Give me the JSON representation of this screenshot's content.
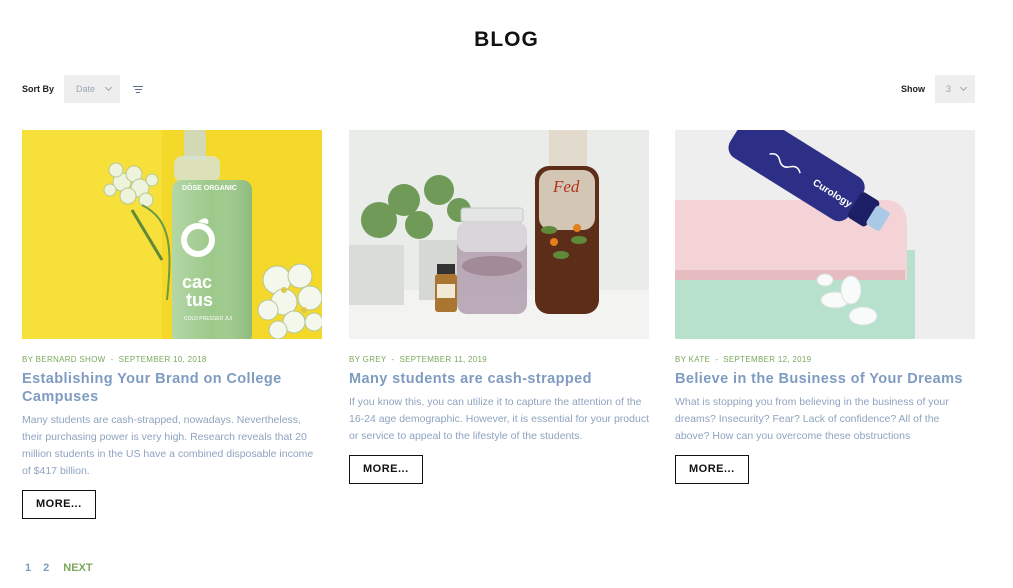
{
  "page": {
    "title": "BLOG"
  },
  "toolbar": {
    "sort_label": "Sort By",
    "sort_value": "Date",
    "show_label": "Show",
    "show_value": "3"
  },
  "posts": [
    {
      "author_prefix": "BY",
      "author": "BERNARD SHOW",
      "date": "SEPTEMBER 10, 2018",
      "title": "Establishing Your Brand on College Campuses",
      "excerpt": "Many students are cash-strapped, nowadays. Nevertheless, their purchasing power is very high. Research reveals that 20 million students in the US have a combined disposable income of $417 billion.",
      "more_label": "MORE...",
      "image": {
        "bottle_brand": "DŌSE ORGANIC",
        "bottle_word_1": "cac",
        "bottle_word_2": "tus",
        "bottle_caption": "COLD PRESSED JUI"
      }
    },
    {
      "author_prefix": "BY",
      "author": "GREY",
      "date": "SEPTEMBER 11, 2019",
      "title": "Many students are cash-strapped",
      "excerpt": "If you know this, you can utilize it to capture the attention of the 16-24 age demographic. However, it is essential for your product or service to appeal to the lifestyle of the students.",
      "more_label": "MORE...",
      "image": {
        "bottle_word": "Fed"
      }
    },
    {
      "author_prefix": "BY",
      "author": "KATE",
      "date": "SEPTEMBER 12, 2019",
      "title": "Believe in the Business of Your Dreams",
      "excerpt": "What is stopping you from believing in the business of your dreams? Insecurity? Fear? Lack of confidence? All of the above? How can you overcome these obstructions",
      "more_label": "MORE...",
      "image": {
        "bottle_word": "Curology"
      }
    }
  ],
  "pagination": {
    "pages": [
      "1",
      "2"
    ],
    "next_label": "NEXT"
  },
  "colors": {
    "accent_green": "#7aa85c",
    "title_blue": "#7f9cc0",
    "text_blue": "#8fa3bf"
  }
}
